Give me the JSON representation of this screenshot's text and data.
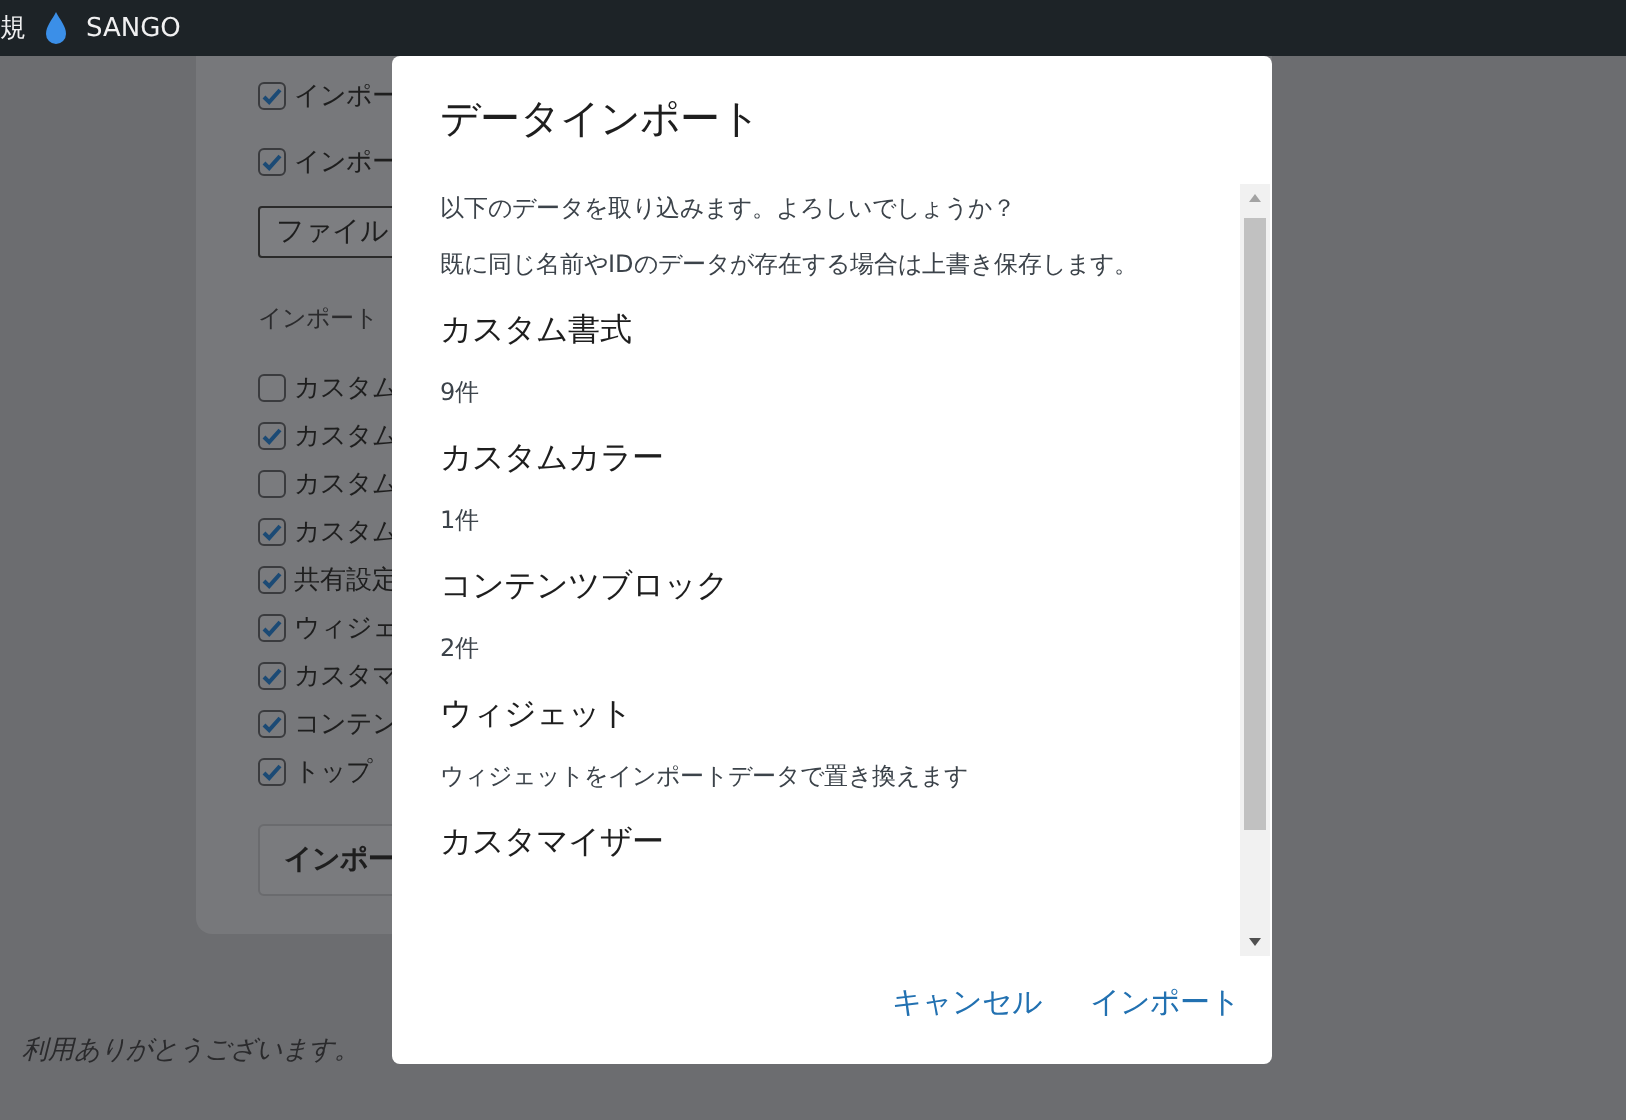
{
  "top_bar": {
    "items": [
      {
        "label": "規"
      },
      {
        "label": "SANGO"
      }
    ]
  },
  "settings": {
    "options": [
      {
        "label": "インポー",
        "checked": true
      },
      {
        "label": "インポー",
        "checked": true
      }
    ],
    "file_button": "ファイル",
    "section_label": "インポート",
    "targets": [
      {
        "label": "カスタム",
        "checked": false
      },
      {
        "label": "カスタム",
        "checked": true
      },
      {
        "label": "カスタム",
        "checked": false
      },
      {
        "label": "カスタム",
        "checked": true
      },
      {
        "label": "共有設定",
        "checked": true
      },
      {
        "label": "ウィジェ",
        "checked": true
      },
      {
        "label": "カスタマ",
        "checked": true
      },
      {
        "label": "コンテン",
        "checked": true
      },
      {
        "label": "トップ",
        "checked": true
      }
    ],
    "import_button": "インポー"
  },
  "footer": "利用ありがとうございます。",
  "dialog": {
    "title": "データインポート",
    "body": [
      {
        "kind": "text",
        "text": "以下のデータを取り込みます。よろしいでしょうか？"
      },
      {
        "kind": "text",
        "text": "既に同じ名前やIDのデータが存在する場合は上書き保存します。"
      },
      {
        "kind": "heading",
        "text": "カスタム書式"
      },
      {
        "kind": "text",
        "text": "9件"
      },
      {
        "kind": "heading",
        "text": "カスタムカラー"
      },
      {
        "kind": "text",
        "text": "1件"
      },
      {
        "kind": "heading",
        "text": "コンテンツブロック"
      },
      {
        "kind": "text",
        "text": "2件"
      },
      {
        "kind": "heading",
        "text": "ウィジェット"
      },
      {
        "kind": "text",
        "text": "ウィジェットをインポートデータで置き換えます"
      },
      {
        "kind": "heading",
        "text": "カスタマイザー"
      }
    ],
    "buttons": [
      "キャンセル",
      "インポート"
    ]
  }
}
